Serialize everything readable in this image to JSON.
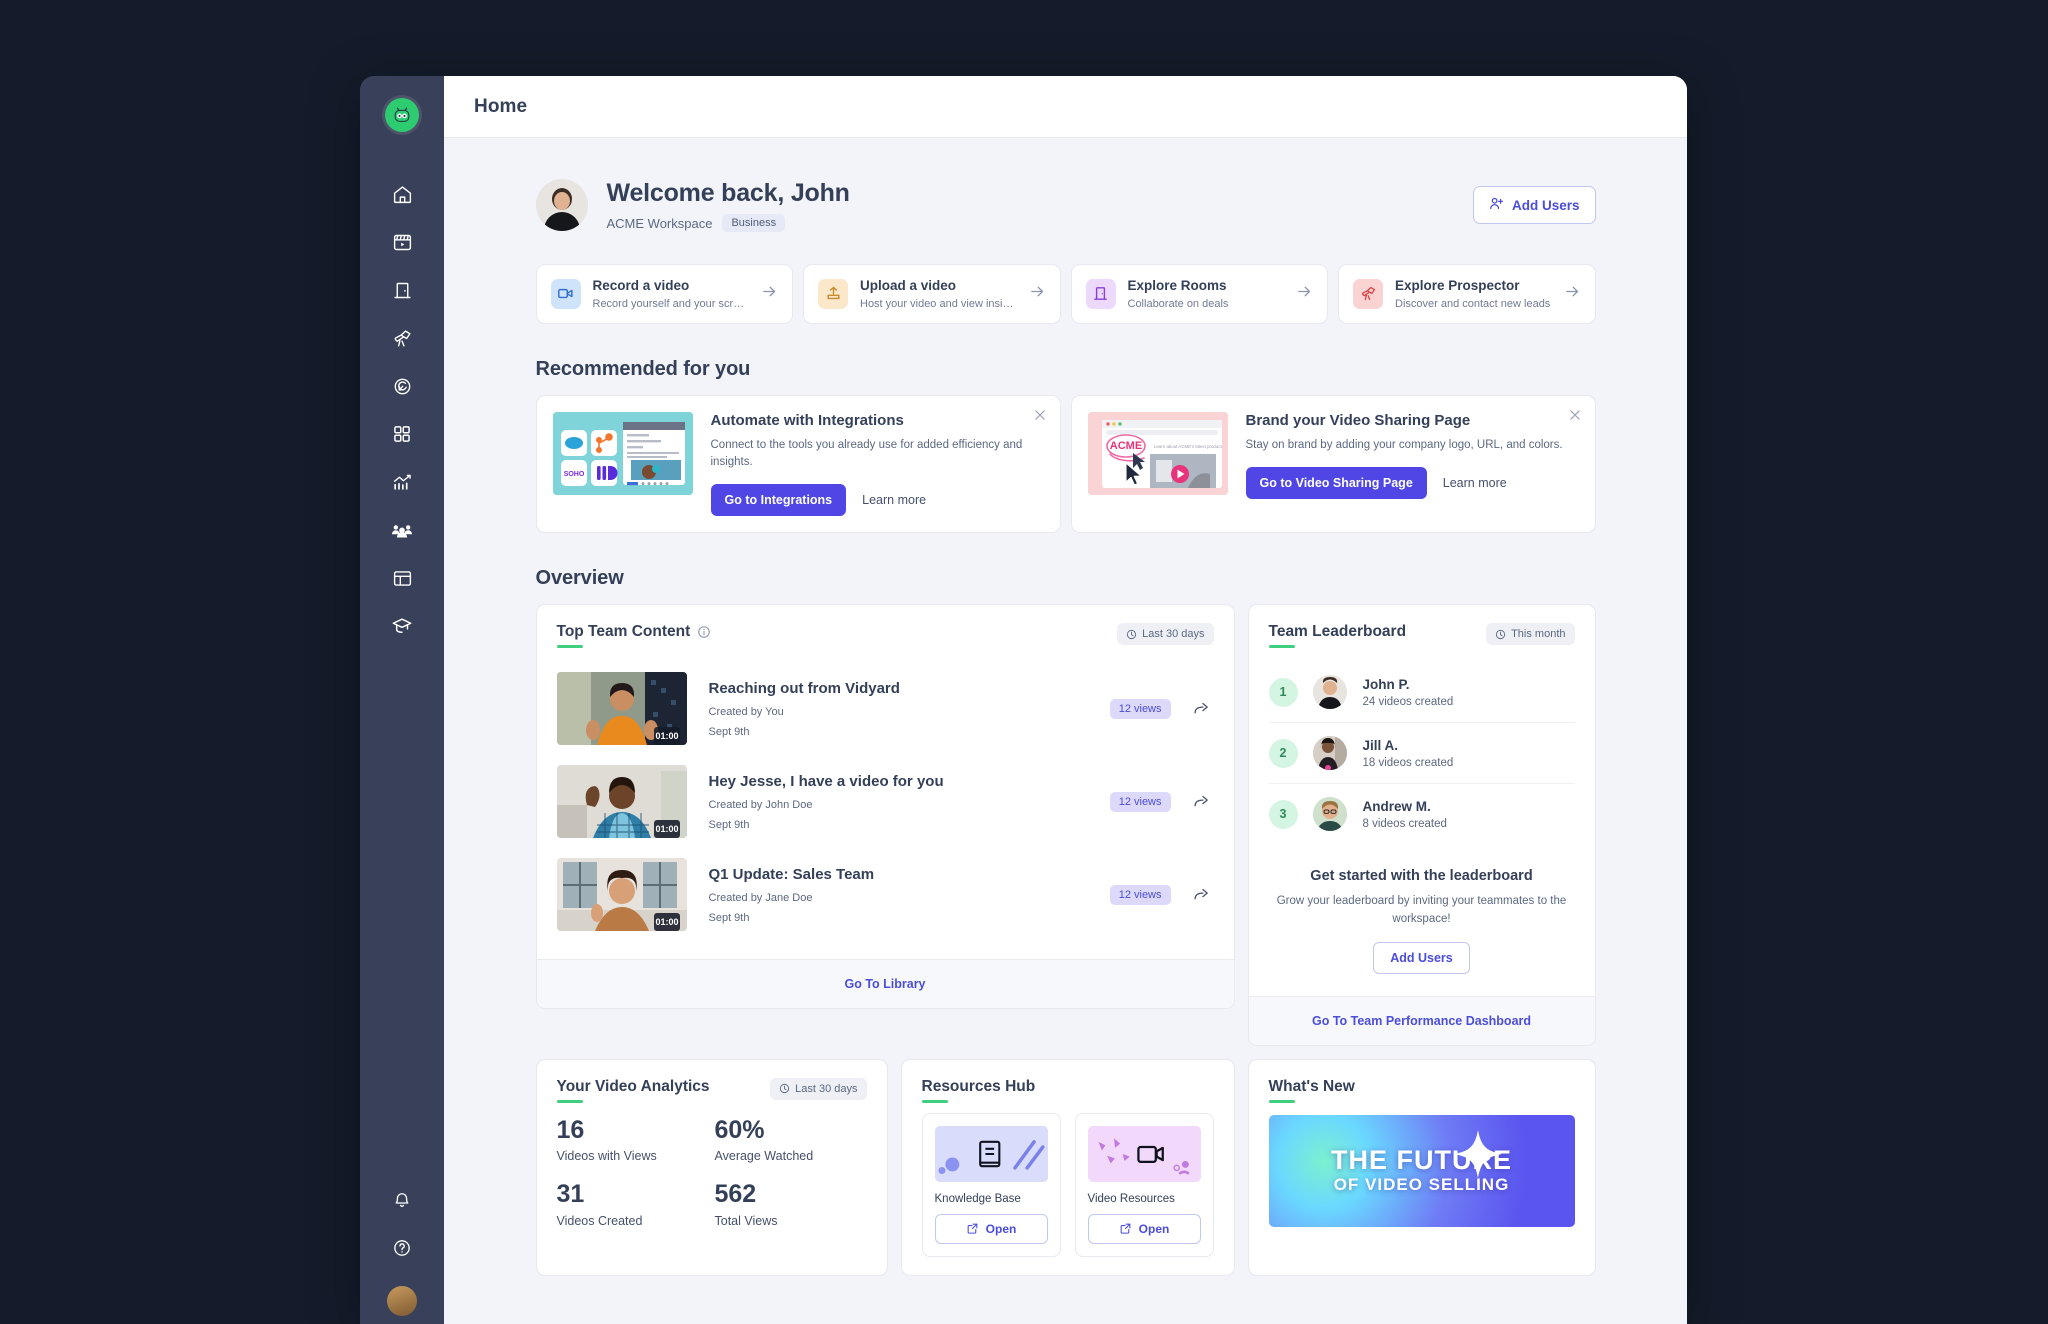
{
  "window": {
    "topbar_title": "Home"
  },
  "sidebar": {
    "logo": "vidyard-robot-logo",
    "items": [
      {
        "name": "home",
        "icon": "home-icon"
      },
      {
        "name": "library",
        "icon": "video-library-icon"
      },
      {
        "name": "rooms",
        "icon": "door-icon"
      },
      {
        "name": "prospector",
        "icon": "telescope-icon"
      },
      {
        "name": "ai-assistant",
        "icon": "magic-circle-icon"
      },
      {
        "name": "apps",
        "icon": "grid-apps-icon"
      },
      {
        "name": "analytics",
        "icon": "chart-line-icon"
      },
      {
        "name": "team",
        "icon": "people-icon"
      },
      {
        "name": "templates",
        "icon": "layout-panel-icon"
      },
      {
        "name": "learning",
        "icon": "graduation-cap-icon"
      }
    ],
    "bottom_items": [
      {
        "name": "notifications",
        "icon": "bell-icon"
      },
      {
        "name": "help",
        "icon": "question-circle-icon"
      },
      {
        "name": "account",
        "icon": "user-avatar"
      }
    ]
  },
  "welcome": {
    "greeting": "Welcome back, John",
    "workspace": "ACME Workspace",
    "plan_badge": "Business",
    "add_users_label": "Add Users",
    "add_users_icon": "user-plus-icon"
  },
  "quick_actions": [
    {
      "title": "Record a video",
      "subtitle": "Record yourself and your screens",
      "icon": "video-camera-icon",
      "icon_bg": "#cfe3fb",
      "icon_color": "#2f6fd0"
    },
    {
      "title": "Upload a video",
      "subtitle": "Host your video and view insights",
      "icon": "upload-icon",
      "icon_bg": "#fbe7c9",
      "icon_color": "#c98b2c"
    },
    {
      "title": "Explore Rooms",
      "subtitle": "Collaborate on deals",
      "icon": "door-icon",
      "icon_bg": "#ecd9fb",
      "icon_color": "#8b3fd6"
    },
    {
      "title": "Explore Prospector",
      "subtitle": "Discover and contact new leads",
      "icon": "telescope-icon",
      "icon_bg": "#fbd3d3",
      "icon_color": "#d84848"
    }
  ],
  "recommended": {
    "heading": "Recommended for you",
    "cards": [
      {
        "title": "Automate with Integrations",
        "description": "Connect to the tools you already use for added efficiency and insights.",
        "primary_label": "Go to Integrations",
        "secondary_label": "Learn more",
        "close_icon": "close-icon",
        "thumb": "integrations-collage"
      },
      {
        "title": "Brand your Video Sharing Page",
        "description": "Stay on brand by adding your company logo, URL, and colors.",
        "primary_label": "Go to Video Sharing Page",
        "secondary_label": "Learn more",
        "close_icon": "close-icon",
        "thumb": "branded-share-page",
        "thumb_brand": "ACME",
        "thumb_caption": "Learn about ACME's latest product"
      }
    ]
  },
  "overview": {
    "heading": "Overview",
    "top_team_content": {
      "title": "Top Team Content",
      "info_icon": "info-icon",
      "range_chip": "Last 30 days",
      "range_chip_icon": "clock-icon",
      "share_icon": "share-icon",
      "videos": [
        {
          "title": "Reaching out from Vidyard",
          "creator": "Created by You",
          "date": "Sept 9th",
          "views": "12 views",
          "duration": "01:00"
        },
        {
          "title": "Hey Jesse, I have a video for you",
          "creator": "Created by John Doe",
          "date": "Sept 9th",
          "views": "12 views",
          "duration": "01:00"
        },
        {
          "title": "Q1 Update: Sales Team",
          "creator": "Created by Jane Doe",
          "date": "Sept 9th",
          "views": "12 views",
          "duration": "01:00"
        }
      ],
      "footer_link": "Go To Library"
    },
    "leaderboard": {
      "title": "Team Leaderboard",
      "range_chip": "This month",
      "range_chip_icon": "clock-icon",
      "entries": [
        {
          "rank": "1",
          "name": "John P.",
          "detail": "24 videos created"
        },
        {
          "rank": "2",
          "name": "Jill A.",
          "detail": "18 videos created"
        },
        {
          "rank": "3",
          "name": "Andrew M.",
          "detail": "8 videos created"
        }
      ],
      "cta_title": "Get started with the leaderboard",
      "cta_text": "Grow your leaderboard by inviting your teammates to the workspace!",
      "cta_button": "Add Users",
      "footer_link": "Go To Team Performance Dashboard"
    }
  },
  "analytics": {
    "title": "Your Video Analytics",
    "range_chip": "Last 30 days",
    "range_chip_icon": "clock-icon",
    "stats": [
      {
        "value": "16",
        "label": "Videos with Views"
      },
      {
        "value": "60%",
        "label": "Average Watched"
      },
      {
        "value": "31",
        "label": "Videos Created"
      },
      {
        "value": "562",
        "label": "Total Views"
      }
    ]
  },
  "resources_hub": {
    "title": "Resources Hub",
    "items": [
      {
        "name": "Knowledge Base",
        "button": "Open",
        "icon": "book-icon",
        "art_bg": "#d9dcfb"
      },
      {
        "name": "Video Resources",
        "button": "Open",
        "icon": "video-camera-icon",
        "art_bg": "#f2d9fb"
      }
    ],
    "open_icon": "external-link-icon"
  },
  "whats_new": {
    "title": "What's New",
    "art_line1": "THE FUTURE",
    "art_line2": "OF VIDEO SELLING"
  },
  "colors": {
    "accent": "#4f46e5",
    "sidebar_bg": "#39415a",
    "page_bg": "#f2f4f9",
    "desktop_bg": "#141c2b",
    "green_underline": "#3fd07f",
    "rank_green": "#2f8a5b"
  }
}
